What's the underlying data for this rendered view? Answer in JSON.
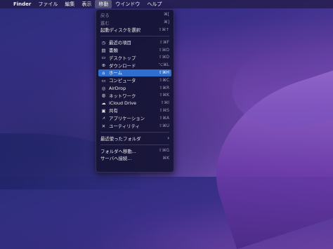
{
  "menubar": {
    "apple_icon": "apple-icon",
    "items": [
      "Finder",
      "ファイル",
      "編集",
      "表示",
      "移動",
      "ウインドウ",
      "ヘルプ"
    ]
  },
  "menu": {
    "top_items": [
      {
        "label": "戻る",
        "shortcut": "⌘["
      },
      {
        "label": "進む",
        "shortcut": "⌘]"
      },
      {
        "label": "起動ディスクを選択",
        "shortcut": "⇧⌘↑"
      }
    ],
    "location_items": [
      {
        "icon": "clock-icon",
        "glyph": "◷",
        "label": "最近の項目",
        "shortcut": "⇧⌘F"
      },
      {
        "icon": "document-icon",
        "glyph": "▤",
        "label": "書類",
        "shortcut": "⇧⌘O"
      },
      {
        "icon": "desktop-icon",
        "glyph": "▭",
        "label": "デスクトップ",
        "shortcut": "⇧⌘D"
      },
      {
        "icon": "download-icon",
        "glyph": "⊕",
        "label": "ダウンロード",
        "shortcut": "⌥⌘L"
      },
      {
        "icon": "home-icon",
        "glyph": "⌂",
        "label": "ホーム",
        "shortcut": "⇧⌘H"
      },
      {
        "icon": "computer-icon",
        "glyph": "▭",
        "label": "コンピュータ",
        "shortcut": "⇧⌘C"
      },
      {
        "icon": "airdrop-icon",
        "glyph": "◎",
        "label": "AirDrop",
        "shortcut": "⇧⌘R"
      },
      {
        "icon": "network-icon",
        "glyph": "◍",
        "label": "ネットワーク",
        "shortcut": "⇧⌘K"
      },
      {
        "icon": "cloud-icon",
        "glyph": "☁",
        "label": "iCloud Drive",
        "shortcut": "⇧⌘I"
      },
      {
        "icon": "shared-icon",
        "glyph": "▣",
        "label": "共有",
        "shortcut": "⇧⌘S"
      },
      {
        "icon": "applications-icon",
        "glyph": "⩘",
        "label": "アプリケーション",
        "shortcut": "⇧⌘A"
      },
      {
        "icon": "utilities-icon",
        "glyph": "✕",
        "label": "ユーティリティ",
        "shortcut": "⇧⌘U"
      }
    ],
    "recent_folders": {
      "label": "最近使ったフォルダ",
      "chevron": "›"
    },
    "goto_folder": {
      "label": "フォルダへ移動...",
      "shortcut": "⇧⌘G"
    },
    "connect_server": {
      "label": "サーバへ接続...",
      "shortcut": "⌘K"
    }
  }
}
